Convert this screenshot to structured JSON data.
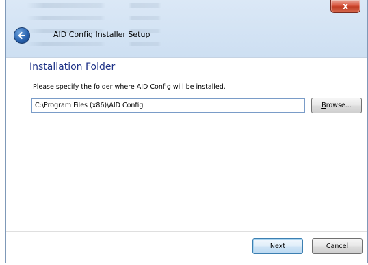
{
  "window": {
    "title": "AID Config Installer Setup",
    "close_label": "x"
  },
  "page": {
    "heading": "Installation Folder",
    "instruction": "Please specify the folder where AID Config will be installed.",
    "install_path": "C:\\Program Files (x86)\\AID Config"
  },
  "buttons": {
    "browse_prefix": "",
    "browse_access": "B",
    "browse_rest": "rowse...",
    "next_access": "N",
    "next_rest": "ext",
    "cancel_label": "Cancel"
  },
  "icons": {
    "back": "back-arrow-icon",
    "close": "close-icon"
  },
  "colors": {
    "heading": "#1e3287",
    "close_button": "#c13d24",
    "back_button": "#2a64b0",
    "default_button_border": "#3c7fb1"
  }
}
